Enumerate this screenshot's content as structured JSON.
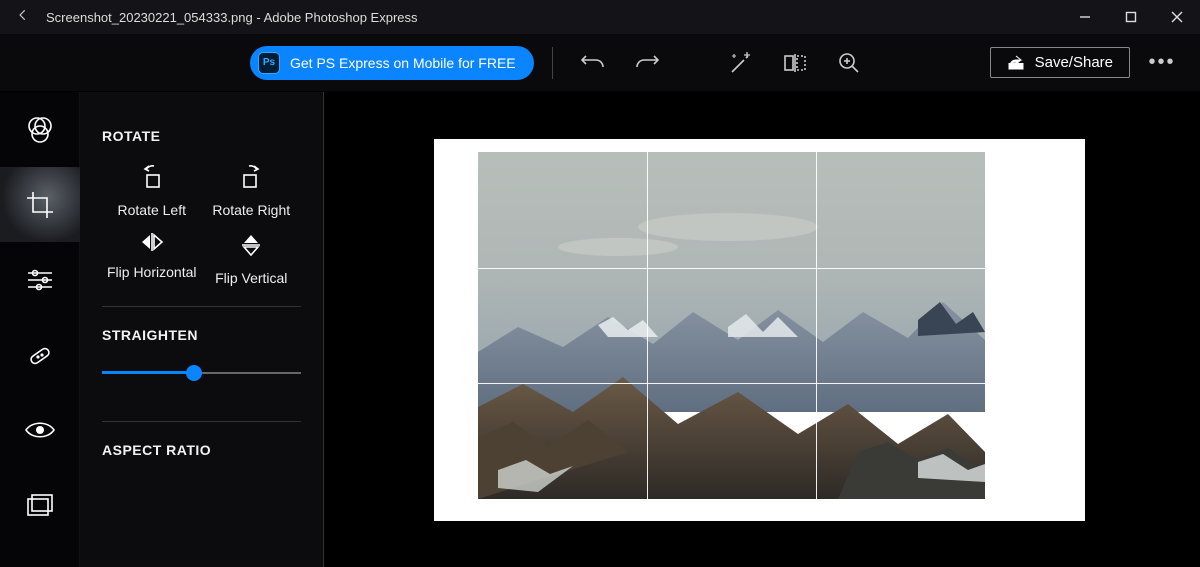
{
  "titlebar": {
    "title": "Screenshot_20230221_054333.png - Adobe Photoshop Express"
  },
  "appbar": {
    "promo_label": "Get PS Express on Mobile for FREE",
    "ps_badge": "Ps",
    "save_label": "Save/Share"
  },
  "toolrail": {
    "items": [
      {
        "name": "adjust"
      },
      {
        "name": "crop",
        "active": true
      },
      {
        "name": "sliders"
      },
      {
        "name": "heal"
      },
      {
        "name": "redeye"
      },
      {
        "name": "borders"
      }
    ]
  },
  "panel": {
    "sections": {
      "rotate": {
        "title": "ROTATE",
        "rotate_left": "Rotate Left",
        "rotate_right": "Rotate Right",
        "flip_h": "Flip Horizontal",
        "flip_v": "Flip Vertical"
      },
      "straighten": {
        "title": "STRAIGHTEN",
        "value_percent": 46
      },
      "aspect_ratio": {
        "title": "ASPECT RATIO"
      }
    }
  }
}
